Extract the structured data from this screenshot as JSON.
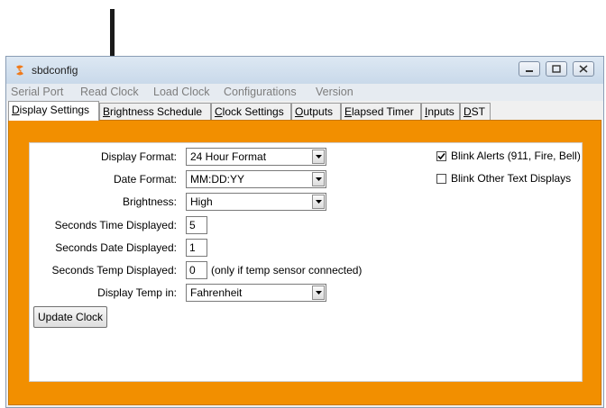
{
  "window": {
    "title": "sbdconfig"
  },
  "menu": [
    "Serial Port",
    "Read Clock",
    "Load Clock",
    "Configurations",
    "Version"
  ],
  "tabs": [
    {
      "label": "Display Settings",
      "underline": "D",
      "rest": "isplay Settings"
    },
    {
      "label": "Brightness Schedule",
      "underline": "B",
      "rest": "rightness Schedule"
    },
    {
      "label": "Clock Settings",
      "underline": "C",
      "rest": "lock Settings"
    },
    {
      "label": "Outputs",
      "underline": "O",
      "rest": "utputs"
    },
    {
      "label": "Elapsed Timer",
      "underline": "E",
      "rest": "lapsed Timer"
    },
    {
      "label": "Inputs",
      "underline": "I",
      "rest": "nputs"
    },
    {
      "label": "DST",
      "underline": "D",
      "rest": "ST"
    }
  ],
  "form": {
    "display_format": {
      "label": "Display Format:",
      "value": "24 Hour Format"
    },
    "date_format": {
      "label": "Date Format:",
      "value": "MM:DD:YY"
    },
    "brightness": {
      "label": "Brightness:",
      "value": "High"
    },
    "seconds_time": {
      "label": "Seconds Time Displayed:",
      "value": "5"
    },
    "seconds_date": {
      "label": "Seconds Date Displayed:",
      "value": "1"
    },
    "seconds_temp": {
      "label": "Seconds Temp Displayed:",
      "value": "0",
      "note": "(only if temp sensor connected)"
    },
    "temp_unit": {
      "label": "Display Temp in:",
      "value": "Fahrenheit"
    }
  },
  "checkboxes": {
    "blink_alerts": {
      "label": "Blink Alerts (911, Fire, Bell)",
      "checked": true
    },
    "blink_other": {
      "label": "Blink Other Text Displays",
      "checked": false
    }
  },
  "buttons": {
    "update": "Update Clock"
  },
  "colors": {
    "frame": "#f28f00",
    "app_icon": "#f07a1a",
    "arrow": "#1a1a1a"
  }
}
